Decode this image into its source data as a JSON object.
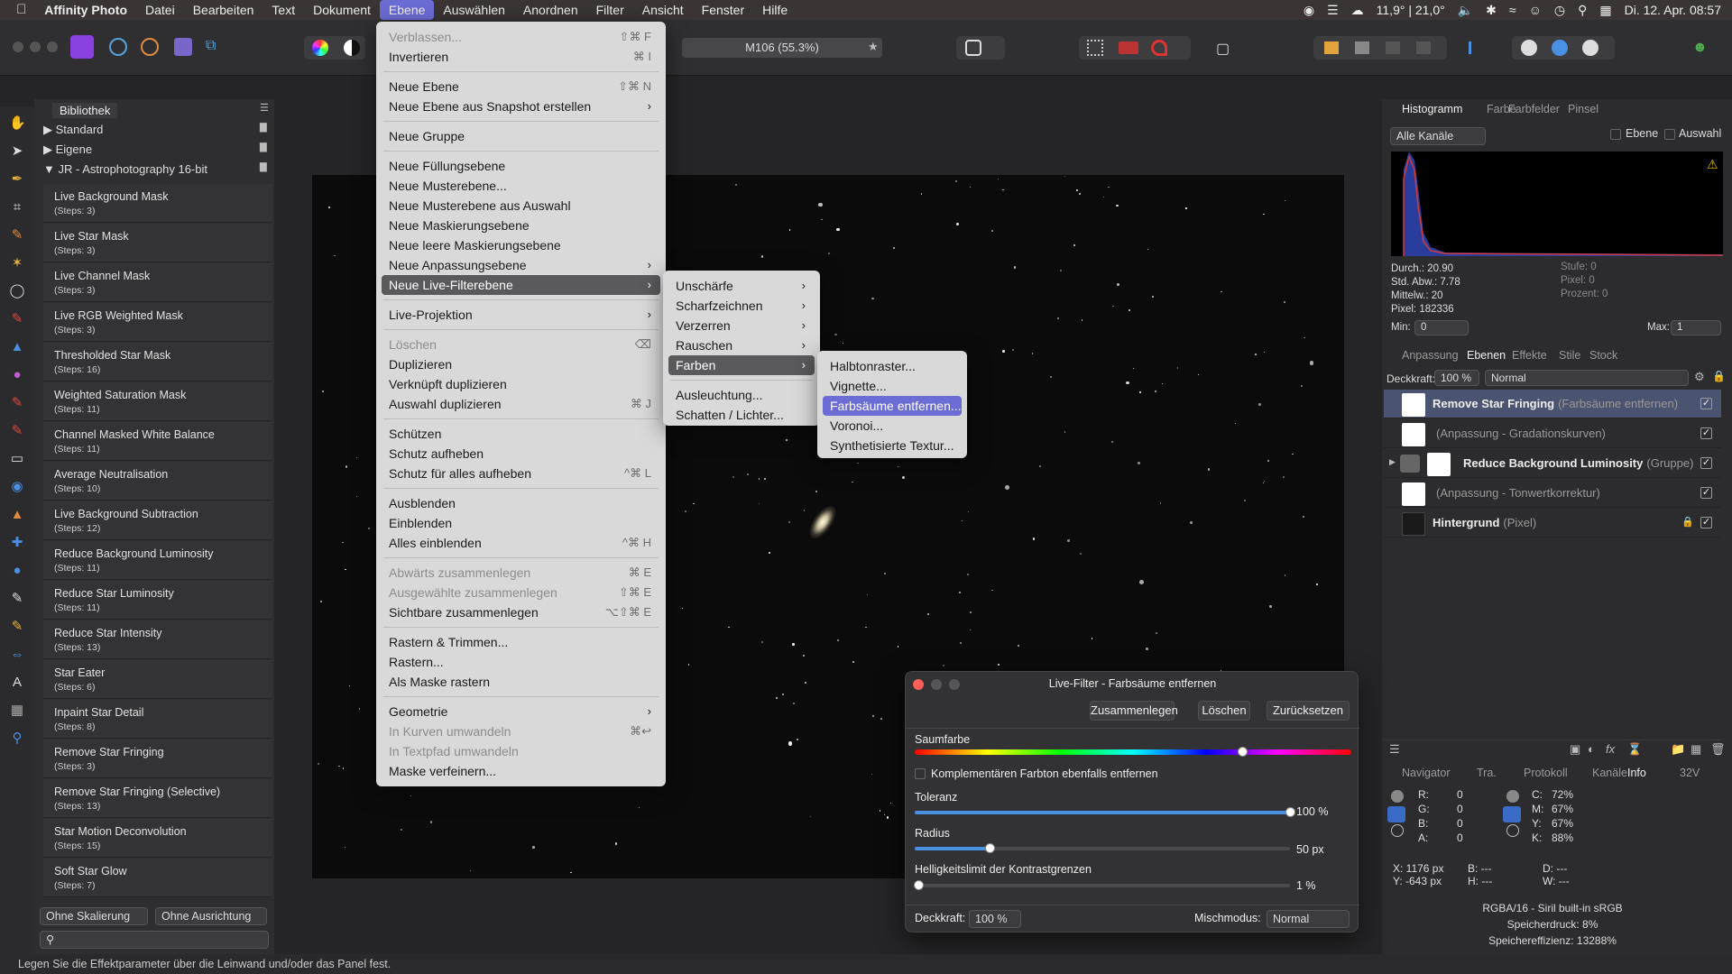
{
  "menubar": {
    "app": "Affinity Photo",
    "items": [
      "Datei",
      "Bearbeiten",
      "Text",
      "Dokument",
      "Ebene",
      "Auswählen",
      "Anordnen",
      "Filter",
      "Ansicht",
      "Fenster",
      "Hilfe"
    ],
    "weather": "11,9° | 21,0°",
    "datetime": "Di. 12. Apr. 08:57"
  },
  "toolbar": {
    "document_title": "M106 (55.3%)"
  },
  "library": {
    "title": "Bibliothek",
    "groups": [
      "Standard",
      "Eigene",
      "JR - Astrophotography 16-bit"
    ],
    "items": [
      {
        "name": "Live Background Mask",
        "steps": "(Steps: 3)"
      },
      {
        "name": "Live Star Mask",
        "steps": "(Steps: 3)"
      },
      {
        "name": "Live Channel Mask",
        "steps": "(Steps: 3)"
      },
      {
        "name": "Live RGB Weighted Mask",
        "steps": "(Steps: 3)"
      },
      {
        "name": "Thresholded Star Mask",
        "steps": "(Steps: 16)"
      },
      {
        "name": "Weighted Saturation Mask",
        "steps": "(Steps: 11)"
      },
      {
        "name": "Channel Masked White Balance",
        "steps": "(Steps: 11)"
      },
      {
        "name": "Average Neutralisation",
        "steps": "(Steps: 10)"
      },
      {
        "name": "Live Background Subtraction",
        "steps": "(Steps: 12)"
      },
      {
        "name": "Reduce Background Luminosity",
        "steps": "(Steps: 11)"
      },
      {
        "name": "Reduce Star Luminosity",
        "steps": "(Steps: 11)"
      },
      {
        "name": "Reduce Star Intensity",
        "steps": "(Steps: 13)"
      },
      {
        "name": "Star Eater",
        "steps": "(Steps: 6)"
      },
      {
        "name": "Inpaint Star Detail",
        "steps": "(Steps: 8)"
      },
      {
        "name": "Remove Star Fringing",
        "steps": "(Steps: 3)"
      },
      {
        "name": "Remove Star Fringing (Selective)",
        "steps": "(Steps: 13)"
      },
      {
        "name": "Star Motion Deconvolution",
        "steps": "(Steps: 15)"
      },
      {
        "name": "Soft Star Glow",
        "steps": "(Steps: 7)"
      }
    ],
    "scaling": "Ohne Skalierung",
    "alignment": "Ohne Ausrichtung"
  },
  "ebene_menu": [
    {
      "label": "Verblassen...",
      "shortcut": "⇧⌘ F",
      "disabled": true
    },
    {
      "label": "Invertieren",
      "shortcut": "⌘ I"
    },
    {
      "sep": true
    },
    {
      "label": "Neue Ebene",
      "shortcut": "⇧⌘ N"
    },
    {
      "label": "Neue Ebene aus Snapshot erstellen",
      "sub": true
    },
    {
      "sep": true
    },
    {
      "label": "Neue Gruppe"
    },
    {
      "sep": true
    },
    {
      "label": "Neue Füllungsebene"
    },
    {
      "label": "Neue Musterebene..."
    },
    {
      "label": "Neue Musterebene aus Auswahl"
    },
    {
      "label": "Neue Maskierungsebene"
    },
    {
      "label": "Neue leere Maskierungsebene"
    },
    {
      "label": "Neue Anpassungsebene",
      "sub": true
    },
    {
      "label": "Neue Live-Filterebene",
      "sub": true,
      "highlight": true
    },
    {
      "sep": true
    },
    {
      "label": "Live-Projektion",
      "sub": true
    },
    {
      "sep": true
    },
    {
      "label": "Löschen",
      "shortcut": "⌫",
      "disabled": true
    },
    {
      "label": "Duplizieren"
    },
    {
      "label": "Verknüpft duplizieren"
    },
    {
      "label": "Auswahl duplizieren",
      "shortcut": "⌘ J"
    },
    {
      "sep": true
    },
    {
      "label": "Schützen"
    },
    {
      "label": "Schutz aufheben"
    },
    {
      "label": "Schutz für alles aufheben",
      "shortcut": "^⌘ L"
    },
    {
      "sep": true
    },
    {
      "label": "Ausblenden"
    },
    {
      "label": "Einblenden"
    },
    {
      "label": "Alles einblenden",
      "shortcut": "^⌘ H"
    },
    {
      "sep": true
    },
    {
      "label": "Abwärts zusammenlegen",
      "shortcut": "⌘ E",
      "disabled": true
    },
    {
      "label": "Ausgewählte zusammenlegen",
      "shortcut": "⇧⌘ E",
      "disabled": true
    },
    {
      "label": "Sichtbare zusammenlegen",
      "shortcut": "⌥⇧⌘ E"
    },
    {
      "sep": true
    },
    {
      "label": "Rastern & Trimmen..."
    },
    {
      "label": "Rastern..."
    },
    {
      "label": "Als Maske rastern"
    },
    {
      "sep": true
    },
    {
      "label": "Geometrie",
      "sub": true
    },
    {
      "label": "In Kurven umwandeln",
      "shortcut": "⌘↩",
      "disabled": true
    },
    {
      "label": "In Textpfad umwandeln",
      "disabled": true
    },
    {
      "label": "Maske verfeinern..."
    }
  ],
  "livefilter_menu": [
    {
      "label": "Unschärfe",
      "sub": true
    },
    {
      "label": "Scharfzeichnen",
      "sub": true
    },
    {
      "label": "Verzerren",
      "sub": true
    },
    {
      "label": "Rauschen",
      "sub": true
    },
    {
      "label": "Farben",
      "sub": true,
      "highlight": true
    },
    {
      "sep": true
    },
    {
      "label": "Ausleuchtung..."
    },
    {
      "label": "Schatten / Lichter..."
    }
  ],
  "farben_menu": [
    {
      "label": "Halbtonraster..."
    },
    {
      "label": "Vignette..."
    },
    {
      "label": "Farbsäume entfernen...",
      "highlight": true
    },
    {
      "label": "Voronoi..."
    },
    {
      "label": "Synthetisierte Textur..."
    }
  ],
  "histogram_panel": {
    "tabs": [
      "Histogramm",
      "Farbe",
      "Farbfelder",
      "Pinsel"
    ],
    "channel": "Alle Kanäle",
    "toggle_layer": "Ebene",
    "toggle_selection": "Auswahl",
    "stats": [
      "Durch.: 20.90",
      "Std. Abw.: 7.78",
      "Mittelw.: 20",
      "Pixel: 182336"
    ],
    "stats_dim": [
      "Stufe: 0",
      "Pixel: 0",
      "Prozent: 0"
    ],
    "min_label": "Min:",
    "min": "0",
    "max_label": "Max:",
    "max": "1"
  },
  "layers_panel": {
    "tabs": [
      "Anpassung",
      "Ebenen",
      "Effekte",
      "Stile",
      "Stock"
    ],
    "opacity_label": "Deckkraft:",
    "opacity": "100 %",
    "blend": "Normal",
    "layers": [
      {
        "name": "Remove Star Fringing",
        "type": "(Farbsäume entfernen)",
        "selected": true
      },
      {
        "name": "",
        "type": "(Anpassung - Gradationskurven)"
      },
      {
        "name": "Reduce Background Luminosity",
        "type": "(Gruppe)"
      },
      {
        "name": "",
        "type": "(Anpassung - Tonwertkorrektur)"
      },
      {
        "name": "Hintergrund",
        "type": "(Pixel)"
      }
    ]
  },
  "info_panel": {
    "tabs": [
      "Navigator",
      "Tra.",
      "Protokoll",
      "Kanäle",
      "Info",
      "32V"
    ],
    "rgba": [
      {
        "k": "R:",
        "v": "0"
      },
      {
        "k": "G:",
        "v": "0"
      },
      {
        "k": "B:",
        "v": "0"
      },
      {
        "k": "A:",
        "v": "0"
      }
    ],
    "cmyk": [
      {
        "k": "C:",
        "v": "72%"
      },
      {
        "k": "M:",
        "v": "67%"
      },
      {
        "k": "Y:",
        "v": "67%"
      },
      {
        "k": "K:",
        "v": "88%"
      }
    ],
    "x": "X: 1176 px",
    "y": "Y: -643 px",
    "b": "B: ---",
    "h": "H: ---",
    "d": "D: ---",
    "w": "W: ---",
    "profile": "RGBA/16 - Siril built-in sRGB",
    "mem_pressure": "Speicherdruck: 8%",
    "mem_eff": "Speichereffizienz: 13288%"
  },
  "dialog": {
    "title": "Live-Filter - Farbsäume entfernen",
    "btn_merge": "Zusammenlegen",
    "btn_delete": "Löschen",
    "btn_reset": "Zurücksetzen",
    "hue_label": "Saumfarbe",
    "hue_position": 0.75,
    "complement_label": "Komplementären Farbton ebenfalls entfernen",
    "tolerance_label": "Toleranz",
    "tolerance": "100 %",
    "tolerance_frac": 1.0,
    "radius_label": "Radius",
    "radius": "50 px",
    "radius_frac": 0.2,
    "brightness_label": "Helligkeitslimit der Kontrastgrenzen",
    "brightness": "1 %",
    "brightness_frac": 0.01,
    "opacity_label": "Deckkraft:",
    "opacity": "100 %",
    "blend_label": "Mischmodus:",
    "blend": "Normal"
  },
  "status": "Legen Sie die Effektparameter über die Leinwand und/oder das Panel fest.",
  "colors": {
    "accent": "#6b6cd4",
    "hist_blue": "#2b3d9c",
    "hist_red": "#d23a3a"
  }
}
